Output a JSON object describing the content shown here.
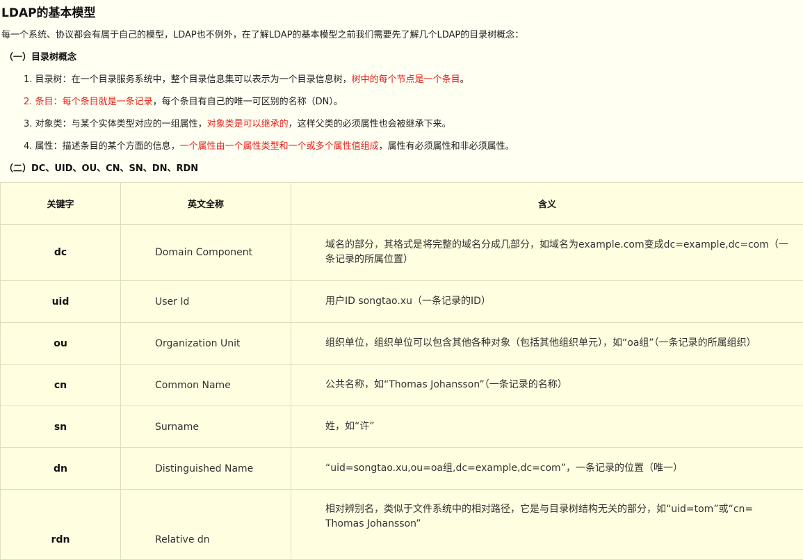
{
  "title": "LDAP的基本模型",
  "intro": "每一个系统、协议都会有属于自己的模型，LDAP也不例外，在了解LDAP的基本模型之前我们需要先了解几个LDAP的目录树概念：",
  "section1": "（一）目录树概念",
  "items": [
    {
      "num": "1.",
      "label": "目录树：",
      "text": "在一个目录服务系统中，整个目录信息集可以表示为一个目录信息树，",
      "highlight": "树中的每个节点是一个条目",
      "tail": "。"
    },
    {
      "num": "2.",
      "label": "条目：",
      "highlight": "每个条目就是一条记录",
      "text": "，每个条目有自己的唯一可区别的名称（DN）。"
    },
    {
      "num": "3.",
      "label": "对象类：",
      "text": "与某个实体类型对应的一组属性，",
      "highlight": "对象类是可以继承的",
      "tail": "，这样父类的必须属性也会被继承下来。"
    },
    {
      "num": "4.",
      "label": "属性：",
      "text": "描述条目的某个方面的信息，",
      "highlight": "一个属性由一个属性类型和一个或多个属性值组成",
      "tail": "，属性有必须属性和非必须属性。"
    }
  ],
  "section2": "（二）DC、UID、OU、CN、SN、DN、RDN",
  "table": {
    "headers": [
      "关键字",
      "英文全称",
      "含义"
    ],
    "rows": [
      {
        "key": "dc",
        "name": "Domain Component",
        "meaning": "域名的部分，其格式是将完整的域名分成几部分，如域名为example.com变成dc=example,dc=com（一条记录的所属位置）"
      },
      {
        "key": "uid",
        "name": "User Id",
        "meaning": "用户ID songtao.xu（一条记录的ID）"
      },
      {
        "key": "ou",
        "name": "Organization Unit",
        "meaning": "组织单位，组织单位可以包含其他各种对象（包括其他组织单元），如“oa组”（一条记录的所属组织）"
      },
      {
        "key": "cn",
        "name": "Common Name",
        "meaning": "公共名称，如“Thomas Johansson”（一条记录的名称）"
      },
      {
        "key": "sn",
        "name": "Surname",
        "meaning": "姓，如“许”"
      },
      {
        "key": "dn",
        "name": "Distinguished Name",
        "meaning": "“uid=songtao.xu,ou=oa组,dc=example,dc=com”，一条记录的位置（唯一）"
      },
      {
        "key": "rdn",
        "name": "Relative dn",
        "meaning": "相对辨别名，类似于文件系统中的相对路径，它是与目录树结构无关的部分，如“uid=tom”或“cn= Thomas Johansson”"
      }
    ]
  },
  "colors": {
    "highlight": "#e0221b",
    "background": "#fffff2",
    "table_bg": "#fffee0"
  }
}
